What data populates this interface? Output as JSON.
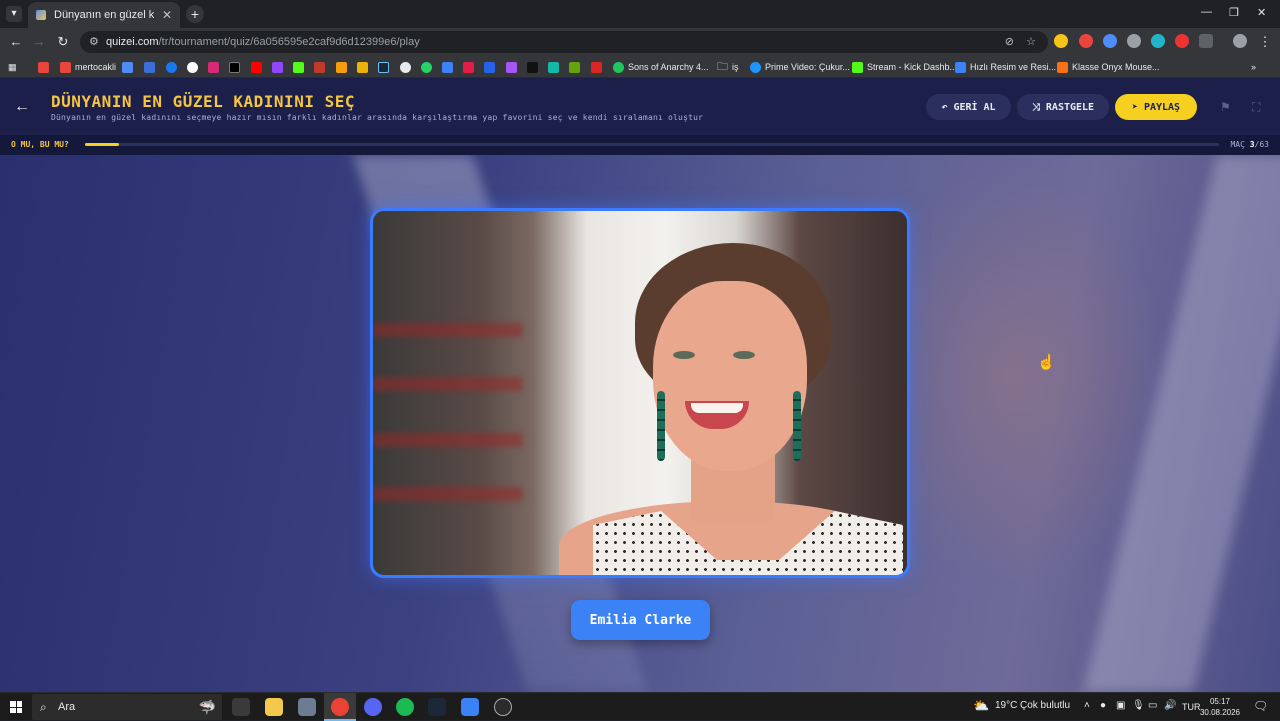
{
  "browser": {
    "tab_title": "Dünyanın en güzel kadınını seç",
    "url_host": "quizei.com",
    "url_path": "/tr/tournament/quiz/6a056595e2caf9d6d12399e6/play",
    "bookmarks": [
      {
        "label": "mertocakli",
        "color": "#e8453c"
      },
      {
        "label": "Sons of Anarchy 4...",
        "color": "#22c55e"
      },
      {
        "label": "iş",
        "color": "#9aa0a6"
      },
      {
        "label": "Prime Video: Çukur...",
        "color": "#1a98ff"
      },
      {
        "label": "Stream - Kick Dashb...",
        "color": "#53fc18"
      },
      {
        "label": "Hızlı Resim ve Resi...",
        "color": "#3b82f6"
      },
      {
        "label": "Klasse Onyx Mouse...",
        "color": "#f97316"
      }
    ]
  },
  "header": {
    "title": "DÜNYANIN EN GÜZEL KADININI SEÇ",
    "subtitle": "Dünyanın en güzel kadınını seçmeye hazır mısın farklı kadınlar arasında karşılaştırma yap favorini seç ve kendi sıralamanı oluştur",
    "undo_label": "GERİ AL",
    "random_label": "RASTGELE",
    "share_label": "PAYLAŞ"
  },
  "progress": {
    "label": "O MU, BU MU?",
    "match_prefix": "MAÇ",
    "current": "3",
    "total": "/63",
    "fraction": 0.03
  },
  "stage": {
    "candidate_name": "Emilia Clarke",
    "accent": "#3b82f6"
  },
  "taskbar": {
    "search_placeholder": "Ara",
    "weather_temp": "19°C",
    "weather_text": "Çok bulutlu",
    "lang": "TUR",
    "time": "05:17",
    "date": "30.08.2026"
  }
}
